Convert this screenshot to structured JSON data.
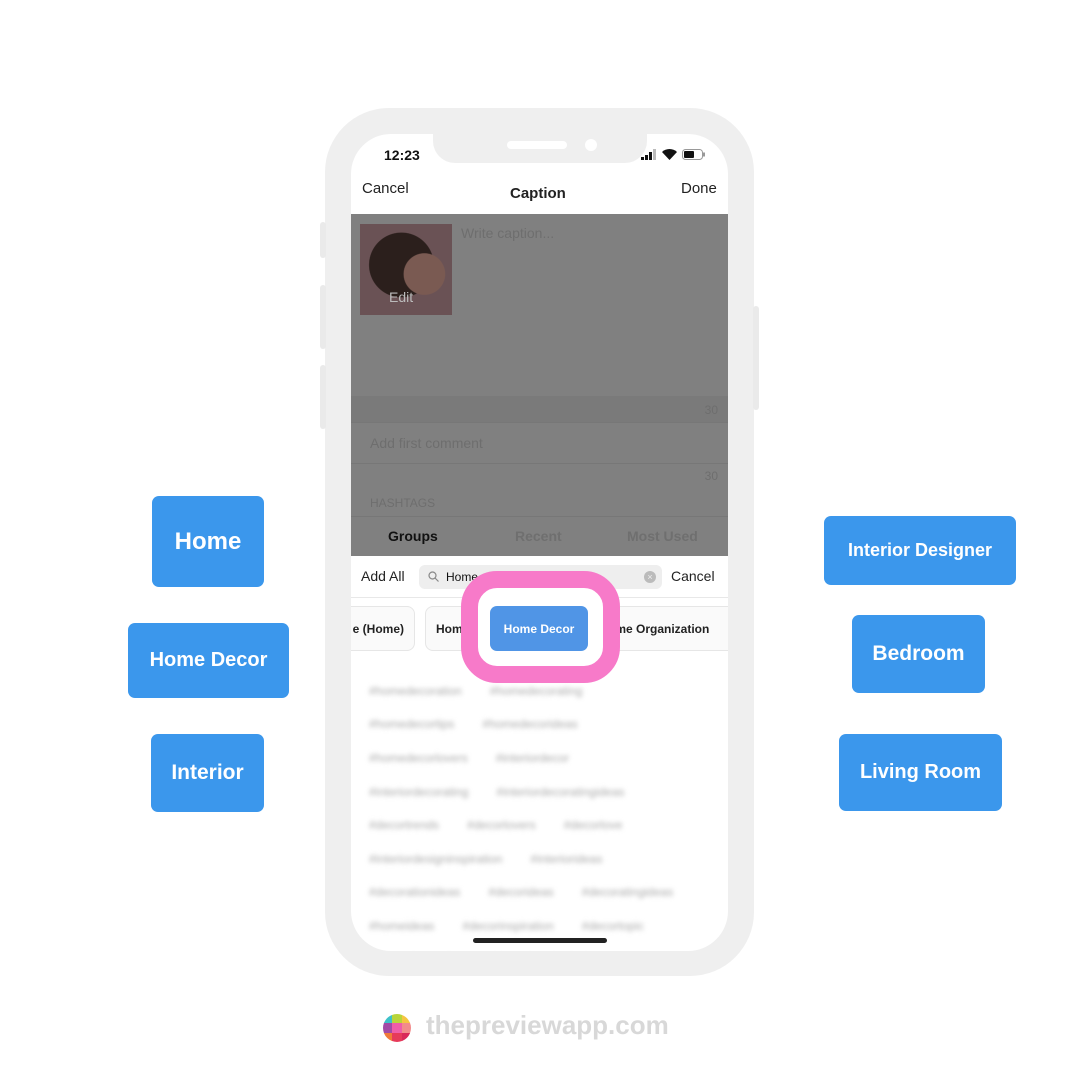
{
  "status": {
    "time": "12:23"
  },
  "nav": {
    "cancel": "Cancel",
    "title": "Caption",
    "done": "Done"
  },
  "post": {
    "edit": "Edit",
    "caption_placeholder": "Write caption...",
    "caption_count": "30",
    "comment_placeholder": "Add first comment",
    "comment_count": "30",
    "hashtags_header": "HASHTAGS"
  },
  "tabs": [
    {
      "label": "Groups",
      "active": true
    },
    {
      "label": "Recent"
    },
    {
      "label": "Most Used"
    }
  ],
  "search": {
    "add_all": "Add All",
    "value": "Home",
    "cancel": "Cancel"
  },
  "chips": [
    "e (Home)",
    "Hom",
    "Home Decor",
    "ome Organization"
  ],
  "labels_left": [
    "Home",
    "Home Decor",
    "Interior"
  ],
  "labels_right": [
    "Interior Designer",
    "Bedroom",
    "Living Room"
  ],
  "brand": "thepreviewapp.com",
  "colors": {
    "accent": "#3b97ec",
    "highlight": "#f77ac9",
    "chip_selected": "#5095e6"
  }
}
